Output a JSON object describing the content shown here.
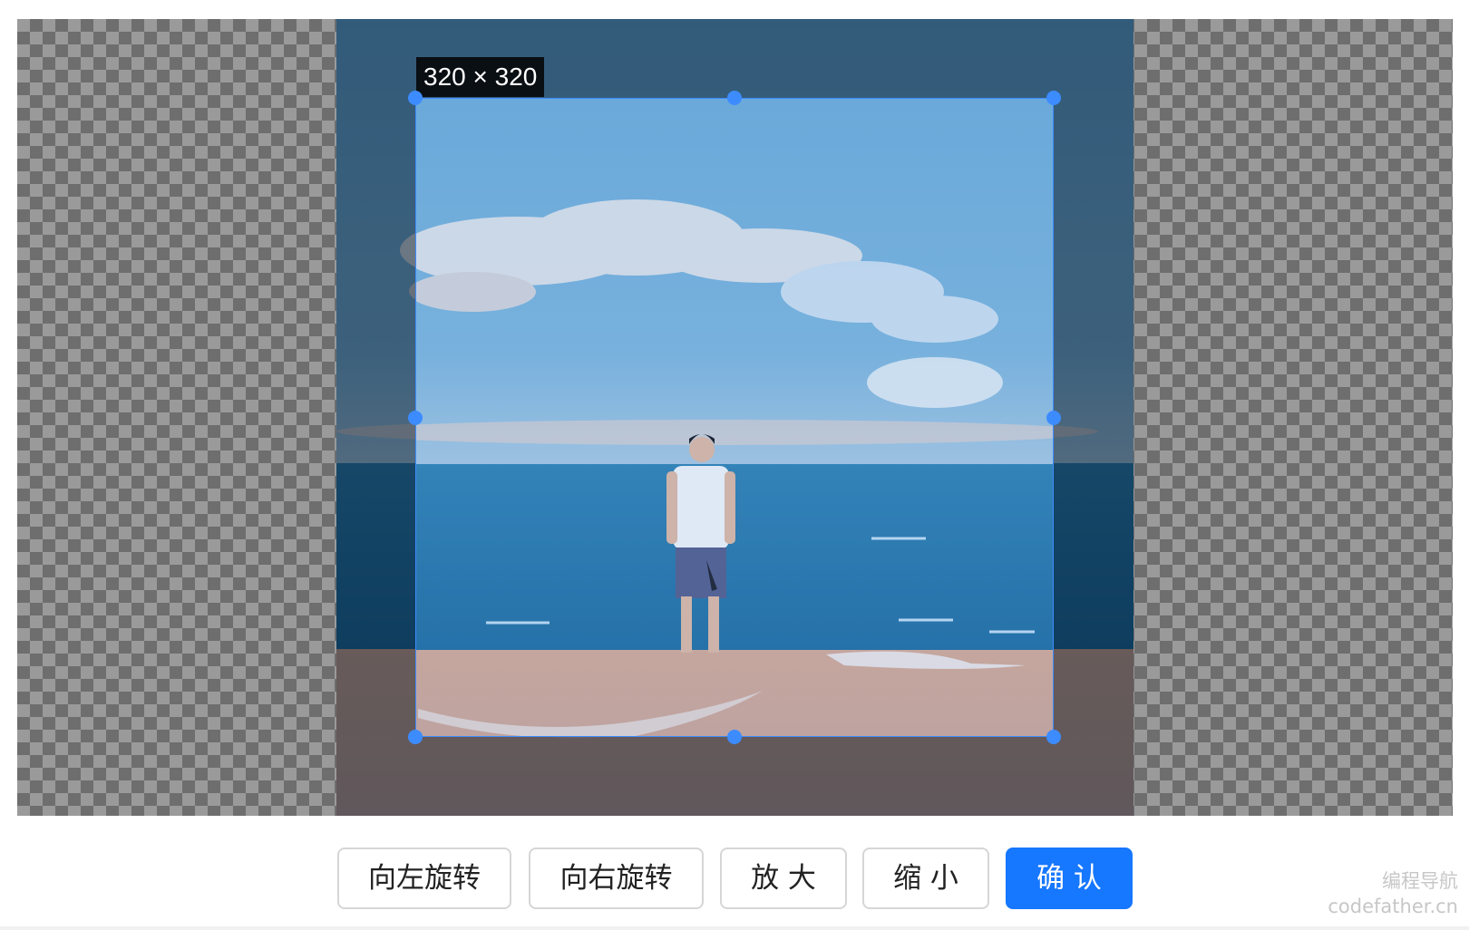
{
  "cropper": {
    "size_label": "320 × 320"
  },
  "toolbar": {
    "rotate_left": "向左旋转",
    "rotate_right": "向右旋转",
    "zoom_in": "放 大",
    "zoom_out": "缩 小",
    "confirm": "确 认"
  },
  "watermark": {
    "line1": "编程导航",
    "line2": "codefather.cn"
  },
  "colors": {
    "accent": "#1677ff",
    "crop_border": "#3d8cff"
  }
}
